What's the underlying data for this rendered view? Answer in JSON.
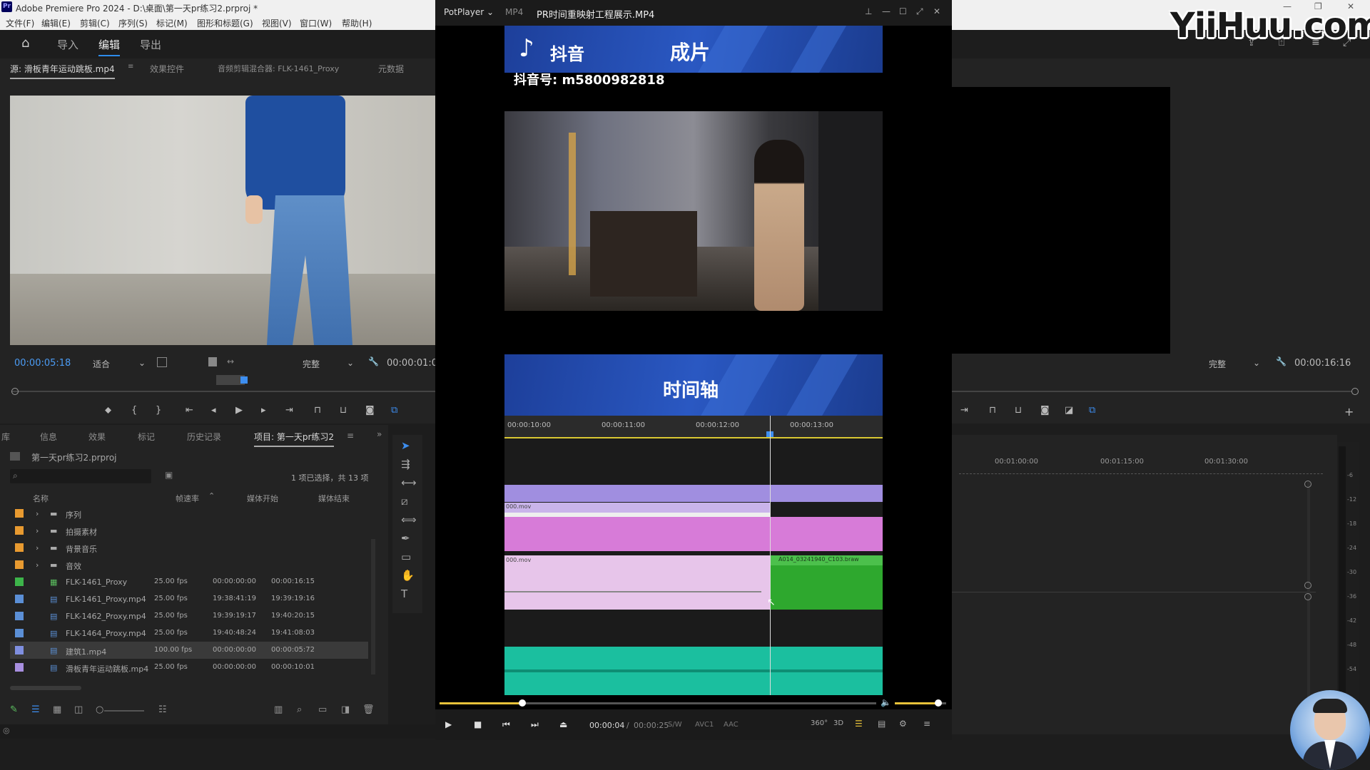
{
  "window": {
    "title": "Adobe Premiere Pro 2024 - D:\\桌面\\第一天pr练习2.prproj *"
  },
  "menu": [
    "文件(F)",
    "编辑(E)",
    "剪辑(C)",
    "序列(S)",
    "标记(M)",
    "图形和标题(G)",
    "视图(V)",
    "窗口(W)",
    "帮助(H)"
  ],
  "workspaces": [
    "导入",
    "编辑",
    "导出"
  ],
  "source_tabs": [
    "源: 滑板青年运动跳板.mp4",
    "效果控件",
    "音频剪辑混合器: FLK-1461_Proxy",
    "元数据"
  ],
  "source": {
    "timecode": "00:00:05:18",
    "fit": "适合",
    "quality": "完整",
    "duration": "00:00:01:0"
  },
  "program": {
    "quality": "完整",
    "timecode": "00:00:16:16",
    "ruler": [
      "00:01:00:00",
      "00:01:15:00",
      "00:01:30:00"
    ]
  },
  "meter_labels": [
    "-6",
    "-12",
    "-18",
    "-24",
    "-30",
    "-36",
    "-42",
    "-48",
    "-54"
  ],
  "project_tabs": [
    "库",
    "信息",
    "效果",
    "标记",
    "历史记录",
    "项目: 第一天pr练习2"
  ],
  "project": {
    "file": "第一天pr练习2.prproj",
    "status": "1 项已选择，共 13 项",
    "columns": [
      "名称",
      "帧速率",
      "媒体开始",
      "媒体结束"
    ],
    "rows": [
      {
        "color": "#e89a30",
        "name": "序列",
        "type": "folder",
        "fps": "",
        "start": "",
        "end": ""
      },
      {
        "color": "#e89a30",
        "name": "拍摄素材",
        "type": "folder",
        "fps": "",
        "start": "",
        "end": ""
      },
      {
        "color": "#e89a30",
        "name": "背景音乐",
        "type": "folder",
        "fps": "",
        "start": "",
        "end": ""
      },
      {
        "color": "#e89a30",
        "name": "音效",
        "type": "folder",
        "fps": "",
        "start": "",
        "end": ""
      },
      {
        "color": "#3db44a",
        "name": "FLK-1461_Proxy",
        "type": "seq",
        "fps": "25.00 fps",
        "start": "00:00:00:00",
        "end": "00:00:16:15"
      },
      {
        "color": "#5b8fd6",
        "name": "FLK-1461_Proxy.mp4",
        "type": "clip",
        "fps": "25.00 fps",
        "start": "19:38:41:19",
        "end": "19:39:19:16"
      },
      {
        "color": "#5b8fd6",
        "name": "FLK-1462_Proxy.mp4",
        "type": "clip",
        "fps": "25.00 fps",
        "start": "19:39:19:17",
        "end": "19:40:20:15"
      },
      {
        "color": "#5b8fd6",
        "name": "FLK-1464_Proxy.mp4",
        "type": "clip",
        "fps": "25.00 fps",
        "start": "19:40:48:24",
        "end": "19:41:08:03"
      },
      {
        "color": "#7f8fe0",
        "name": "建筑1.mp4",
        "type": "clip",
        "fps": "100.00 fps",
        "start": "00:00:00:00",
        "end": "00:00:05:72"
      },
      {
        "color": "#a88fe0",
        "name": "滑板青年运动跳板.mp4",
        "type": "clip",
        "fps": "25.00 fps",
        "start": "00:00:00:00",
        "end": "00:00:10:01"
      }
    ]
  },
  "potplayer": {
    "app": "PotPlayer",
    "format": "MP4",
    "file": "PR时间重映射工程展示.MP4",
    "douyin": "抖音",
    "chengpian": "成片",
    "account": "抖音号: m5800982818",
    "timeline_title": "时间轴",
    "ruler": [
      "00:00:10:00",
      "00:00:11:00",
      "00:00:12:00",
      "00:00:13:00"
    ],
    "clip1": "000.mov",
    "clip2": "000.mov",
    "clip3": "A014_03241940_C103.braw",
    "time_current": "00:00:04",
    "time_total": "00:00:25",
    "tags": [
      "S/W",
      "AVC1",
      "AAC"
    ],
    "progress": 0.19,
    "volume": 0.85
  },
  "watermark": "YiiHuu.com"
}
